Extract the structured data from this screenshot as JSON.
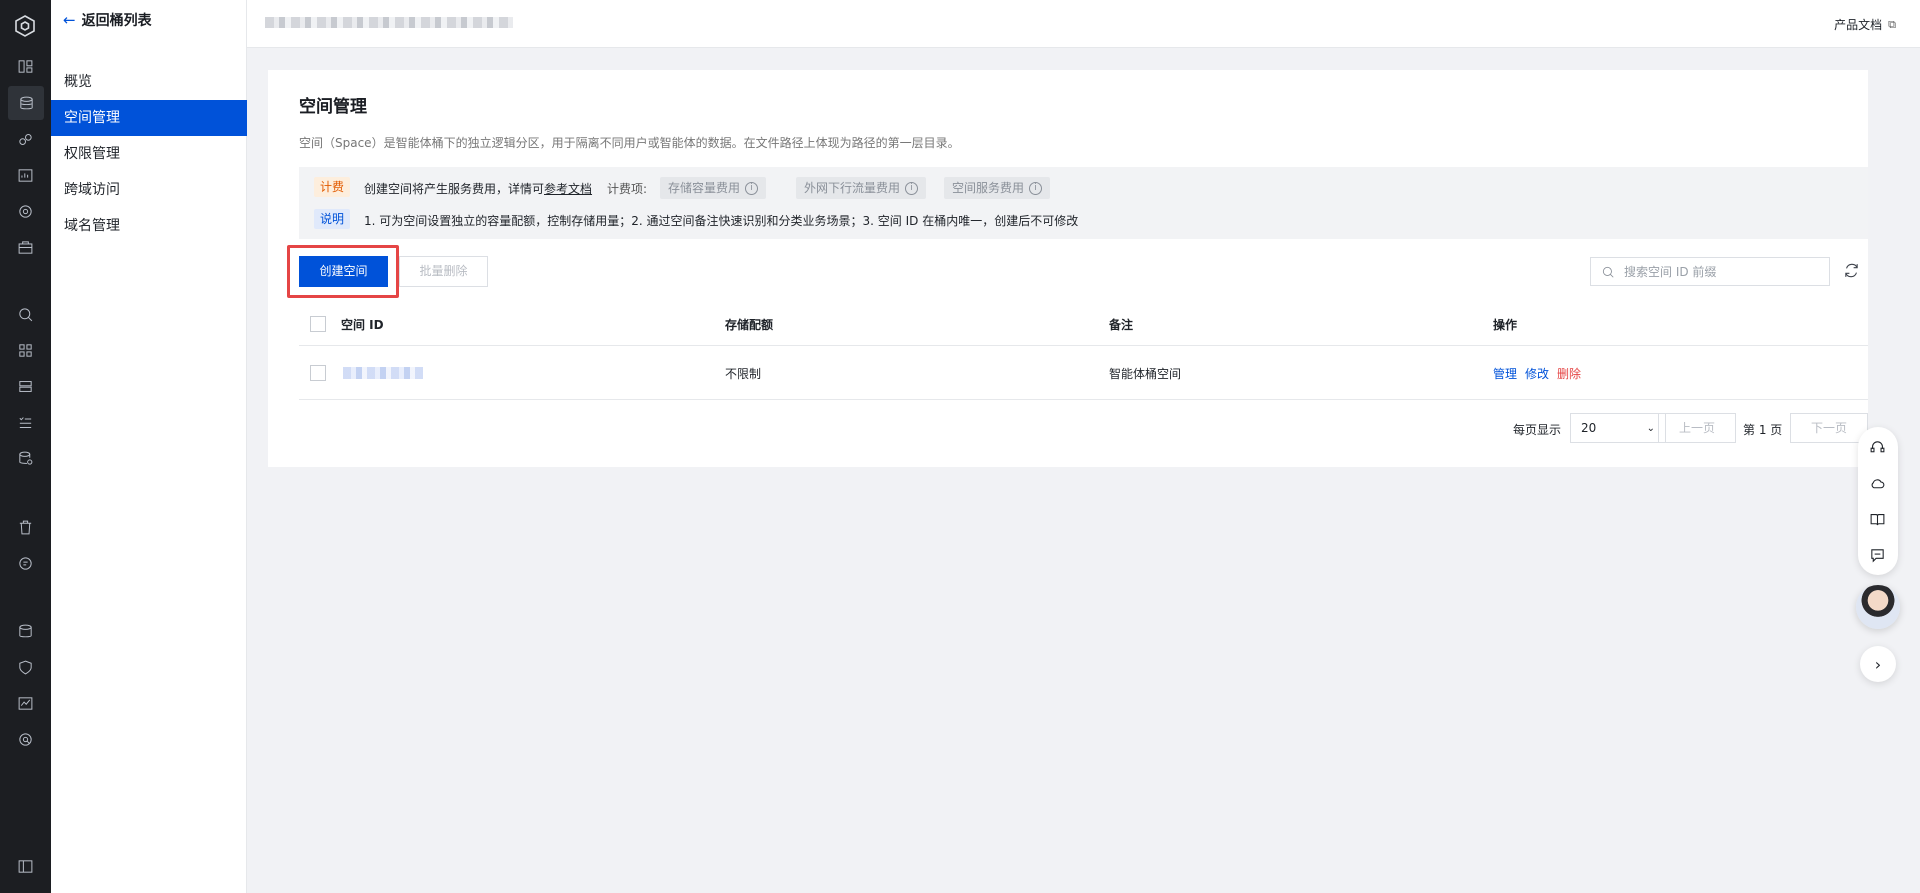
{
  "nav": {
    "back_label": "返回桶列表",
    "items": [
      {
        "label": "概览"
      },
      {
        "label": "空间管理",
        "active": true
      },
      {
        "label": "权限管理"
      },
      {
        "label": "跨域访问"
      },
      {
        "label": "域名管理"
      }
    ]
  },
  "header": {
    "doc_link": "产品文档"
  },
  "page": {
    "title": "空间管理",
    "description": "空间（Space）是智能体桶下的独立逻辑分区，用于隔离不同用户或智能体的数据。在文件路径上体现为路径的第一层目录。"
  },
  "notice": {
    "fee_tag": "计费",
    "fee_text": "创建空间将产生服务费用，详情可",
    "fee_link": "参考文档",
    "fee_items_label": "计费项:",
    "fee_items": [
      "存储容量费用",
      "外网下行流量费用",
      "空间服务费用"
    ],
    "note_tag": "说明",
    "note_text": "1. 可为空间设置独立的容量配额，控制存储用量；2. 通过空间备注快速识别和分类业务场景；3. 空间 ID 在桶内唯一，创建后不可修改"
  },
  "toolbar": {
    "create_label": "创建空间",
    "batch_delete_label": "批量删除",
    "search_placeholder": "搜索空间 ID 前缀"
  },
  "table": {
    "columns": [
      "空间 ID",
      "存储配额",
      "备注",
      "操作"
    ],
    "rows": [
      {
        "quota": "不限制",
        "remark": "智能体桶空间",
        "actions": [
          "管理",
          "修改",
          "删除"
        ]
      }
    ]
  },
  "pagination": {
    "per_page_label": "每页显示",
    "per_page_value": "20",
    "prev_label": "上一页",
    "page_label": "第 1 页",
    "next_label": "下一页"
  },
  "colors": {
    "primary": "#0052d9",
    "danger": "#e54545",
    "rail_bg": "#1c1e22"
  }
}
